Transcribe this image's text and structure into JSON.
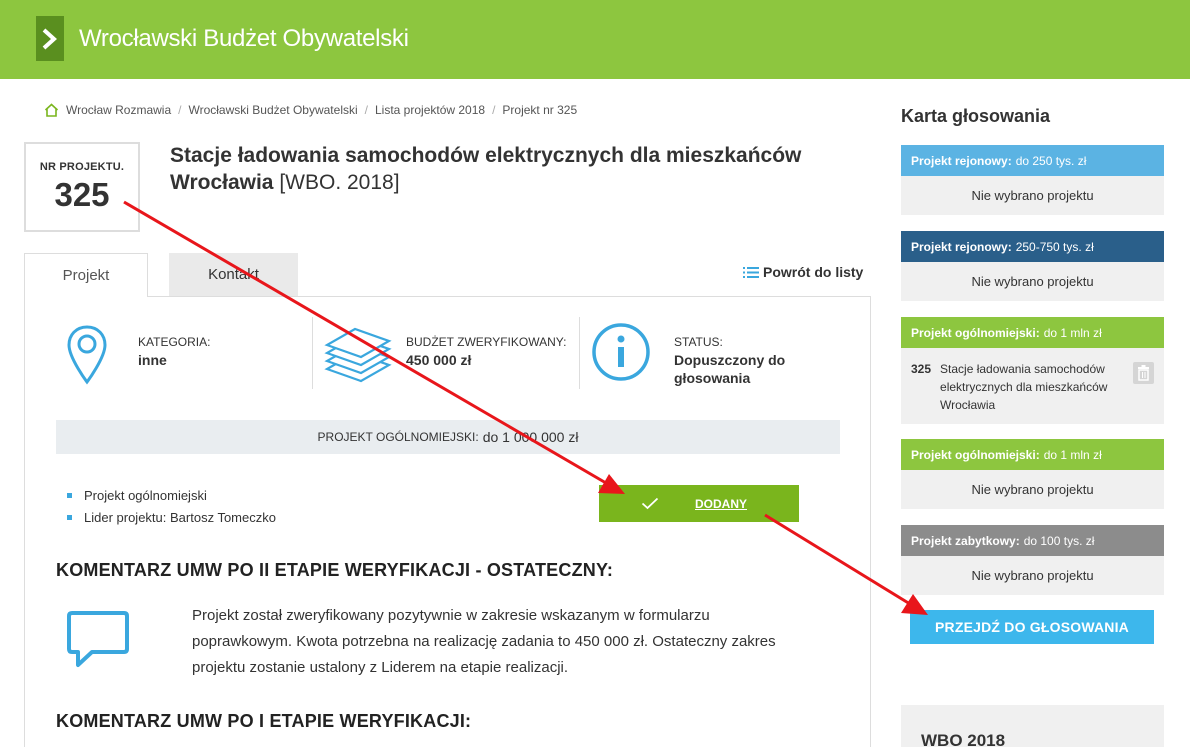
{
  "header": {
    "site_title": "Wrocławski Budżet Obywatelski"
  },
  "breadcrumb": {
    "items": [
      "Wrocław Rozmawia",
      "Wrocławski Budżet Obywatelski",
      "Lista projektów 2018",
      "Projekt nr 325"
    ]
  },
  "project": {
    "nr_label": "NR PROJEKTU.",
    "nr_value": "325",
    "title": "Stacje ładowania samochodów elektrycznych dla mieszkańców Wrocławia",
    "title_tag": "[WBO. 2018]"
  },
  "tabs": [
    {
      "label": "Projekt",
      "active": true
    },
    {
      "label": "Kontakt",
      "active": false
    }
  ],
  "back_link": "Powrót do listy",
  "info": {
    "category_label": "KATEGORIA:",
    "category_value": "inne",
    "budget_label": "BUDŻET ZWERYFIKOWANY:",
    "budget_value": "450 000 zł",
    "status_label": "STATUS:",
    "status_value": "Dopuszczony do głosowania"
  },
  "scope_bar": {
    "label": "PROJEKT OGÓLNOMIEJSKI:",
    "value": "do 1 000 000 zł"
  },
  "bullets": [
    "Projekt ogólnomiejski",
    "Lider projektu: Bartosz Tomeczko"
  ],
  "added_button": "DODANY",
  "comments": {
    "heading_2": "KOMENTARZ UMW PO II ETAPIE WERYFIKACJI - OSTATECZNY:",
    "text_2": "Projekt został zweryfikowany pozytywnie w zakresie wskazanym w formularzu poprawkowym. Kwota potrzebna na realizację zadania to 450 000 zł. Ostateczny zakres projektu zostanie ustalony z Liderem na etapie realizacji.",
    "heading_1": "KOMENTARZ UMW PO I ETAPIE WERYFIKACJI:"
  },
  "sidebar": {
    "title": "Karta głosowania",
    "cards": [
      {
        "kind": "Projekt rejonowy:",
        "limit": "do 250 tys. zł",
        "color": "#5bb3e3",
        "body": "Nie wybrano projektu"
      },
      {
        "kind": "Projekt rejonowy:",
        "limit": "250-750 tys. zł",
        "color": "#2a5f8a",
        "body": "Nie wybrano projektu"
      },
      {
        "kind": "Projekt ogólnomiejski:",
        "limit": "do 1 mln zł",
        "color": "#8dc63f",
        "item_num": "325",
        "item_text": "Stacje ładowania samochodów elektrycznych dla mieszkańców Wrocławia"
      },
      {
        "kind": "Projekt ogólnomiejski:",
        "limit": "do 1 mln zł",
        "color": "#8dc63f",
        "body": "Nie wybrano projektu"
      },
      {
        "kind": "Projekt zabytkowy:",
        "limit": "do 100 tys. zł",
        "color": "#8c8c8c",
        "body": "Nie wybrano projektu"
      }
    ],
    "go_button": "PRZEJDŹ DO GŁOSOWANIA",
    "wbo_title": "WBO 2018"
  },
  "colors": {
    "green": "#8dc63f",
    "blue": "#3db7ec",
    "arrow": "#e8161b"
  },
  "icons": [
    "chevron-right-icon",
    "home-icon",
    "list-icon",
    "map-pin-icon",
    "money-stack-icon",
    "info-icon",
    "check-icon",
    "comment-icon",
    "trash-icon"
  ]
}
